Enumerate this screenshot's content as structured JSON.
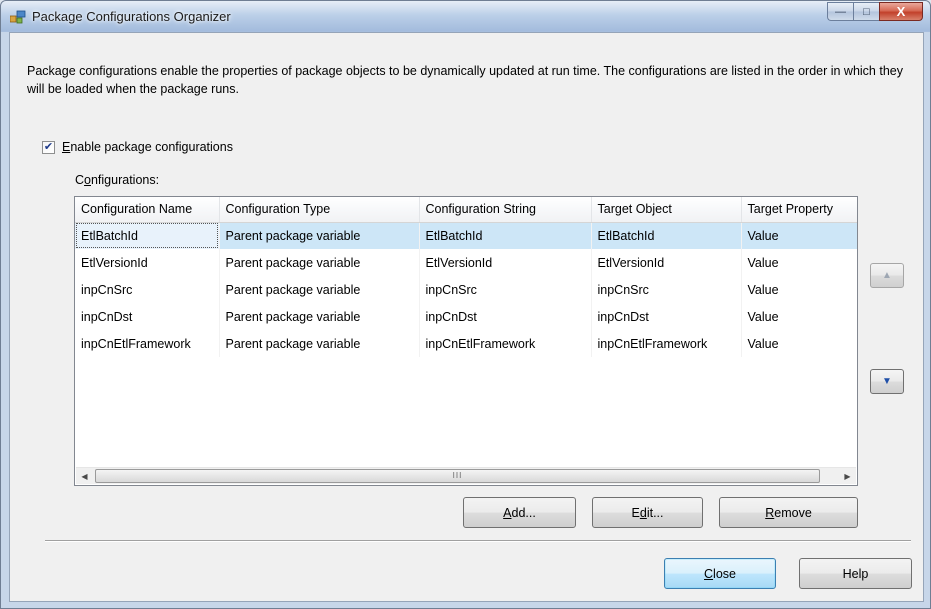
{
  "window": {
    "title": "Package Configurations Organizer",
    "caption_minimize": "—",
    "caption_maximize": "□",
    "caption_close": "X"
  },
  "description": "Package configurations enable the properties of package objects to be dynamically updated at run time. The configurations are listed in the order in which they will be loaded when the package runs.",
  "enable": {
    "checked": true,
    "mnemonic": "E",
    "label_rest": "nable package configurations"
  },
  "configurations": {
    "label_prefix": "C",
    "mnemonic": "o",
    "label_rest": "nfigurations:",
    "columns": [
      "Configuration Name",
      "Configuration Type",
      "Configuration String",
      "Target Object",
      "Target Property"
    ],
    "rows": [
      [
        "EtlBatchId",
        "Parent package variable",
        "EtlBatchId",
        "EtlBatchId",
        "Value"
      ],
      [
        "EtlVersionId",
        "Parent package variable",
        "EtlVersionId",
        "EtlVersionId",
        "Value"
      ],
      [
        "inpCnSrc",
        "Parent package variable",
        "inpCnSrc",
        "inpCnSrc",
        "Value"
      ],
      [
        "inpCnDst",
        "Parent package variable",
        "inpCnDst",
        "inpCnDst",
        "Value"
      ],
      [
        "inpCnEtlFramework",
        "Parent package variable",
        "inpCnEtlFramework",
        "inpCnEtlFramework",
        "Value"
      ]
    ],
    "selected_row": 0,
    "scrollbar_grip": "III"
  },
  "buttons": {
    "add": {
      "mnemonic": "A",
      "rest": "dd..."
    },
    "edit": {
      "prefix": "E",
      "mnemonic": "d",
      "rest": "it..."
    },
    "remove": {
      "mnemonic": "R",
      "rest": "emove"
    },
    "close": {
      "mnemonic": "C",
      "rest": "lose"
    },
    "help": "Help"
  },
  "icons": {
    "title_icon": "package-config-icon",
    "move_up": "arrow-up-icon",
    "move_down": "arrow-down-icon"
  }
}
